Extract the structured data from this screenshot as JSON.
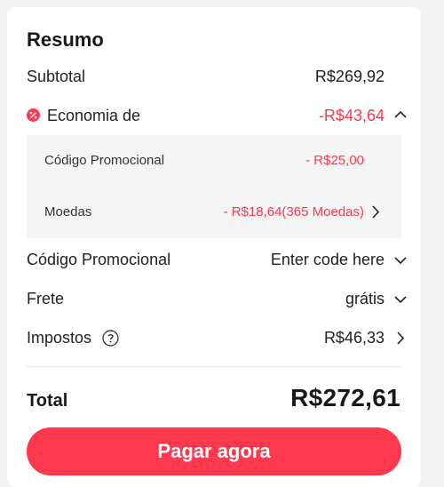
{
  "summary": {
    "title": "Resumo",
    "subtotal_label": "Subtotal",
    "subtotal_value": "R$269,92",
    "savings_label": "Economia de",
    "savings_value": "-R$43,64",
    "breakdown": {
      "promo_label": "Código Promocional",
      "promo_value": "- R$25,00",
      "coins_label": "Moedas",
      "coins_value": "- R$18,64(365 Moedas)"
    },
    "promo_code_label": "Código Promocional",
    "promo_code_placeholder": "Enter code here",
    "shipping_label": "Frete",
    "shipping_value": "grátis",
    "taxes_label": "Impostos",
    "taxes_value": "R$46,33",
    "total_label": "Total",
    "total_value": "R$272,61",
    "pay_button": "Pagar agora"
  },
  "colors": {
    "accent": "#fd384f",
    "text": "#191919",
    "breakdown_bg": "#f5f5f5",
    "page_bg": "#f3f3f3"
  },
  "icons": [
    "discount-badge-icon",
    "chevron-up-icon",
    "chevron-right-icon",
    "chevron-down-icon",
    "help-circle-icon"
  ]
}
